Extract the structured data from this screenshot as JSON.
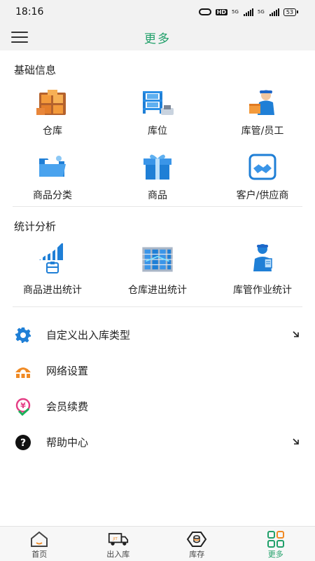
{
  "status_bar": {
    "time": "18:16",
    "network": "5G",
    "hd": "HD",
    "battery": "53"
  },
  "header": {
    "title": "更多"
  },
  "sections": [
    {
      "title": "基础信息",
      "items": [
        {
          "label": "仓库",
          "icon": "warehouse-icon"
        },
        {
          "label": "库位",
          "icon": "storage-rack-icon"
        },
        {
          "label": "库管/员工",
          "icon": "staff-icon"
        },
        {
          "label": "商品分类",
          "icon": "folder-icon"
        },
        {
          "label": "商品",
          "icon": "gift-box-icon"
        },
        {
          "label": "客户/供应商",
          "icon": "handshake-icon"
        }
      ]
    },
    {
      "title": "统计分析",
      "items": [
        {
          "label": "商品进出统计",
          "icon": "bar-chart-icon"
        },
        {
          "label": "仓库进出统计",
          "icon": "server-rack-icon"
        },
        {
          "label": "库管作业统计",
          "icon": "worker-icon"
        }
      ]
    }
  ],
  "menu": [
    {
      "label": "自定义出入库类型",
      "icon": "gear-icon",
      "arrow": true
    },
    {
      "label": "网络设置",
      "icon": "network-icon",
      "arrow": false
    },
    {
      "label": "会员续费",
      "icon": "yen-badge-icon",
      "arrow": false
    },
    {
      "label": "帮助中心",
      "icon": "help-icon",
      "arrow": true
    }
  ],
  "bottom_nav": [
    {
      "label": "首页",
      "icon": "home-icon",
      "active": false
    },
    {
      "label": "出入库",
      "icon": "truck-icon",
      "active": false
    },
    {
      "label": "库存",
      "icon": "inventory-icon",
      "active": false
    },
    {
      "label": "更多",
      "icon": "more-grid-icon",
      "active": true
    }
  ],
  "colors": {
    "accent": "#21a06a",
    "blue": "#1f7fd6",
    "orange": "#f08a24"
  }
}
